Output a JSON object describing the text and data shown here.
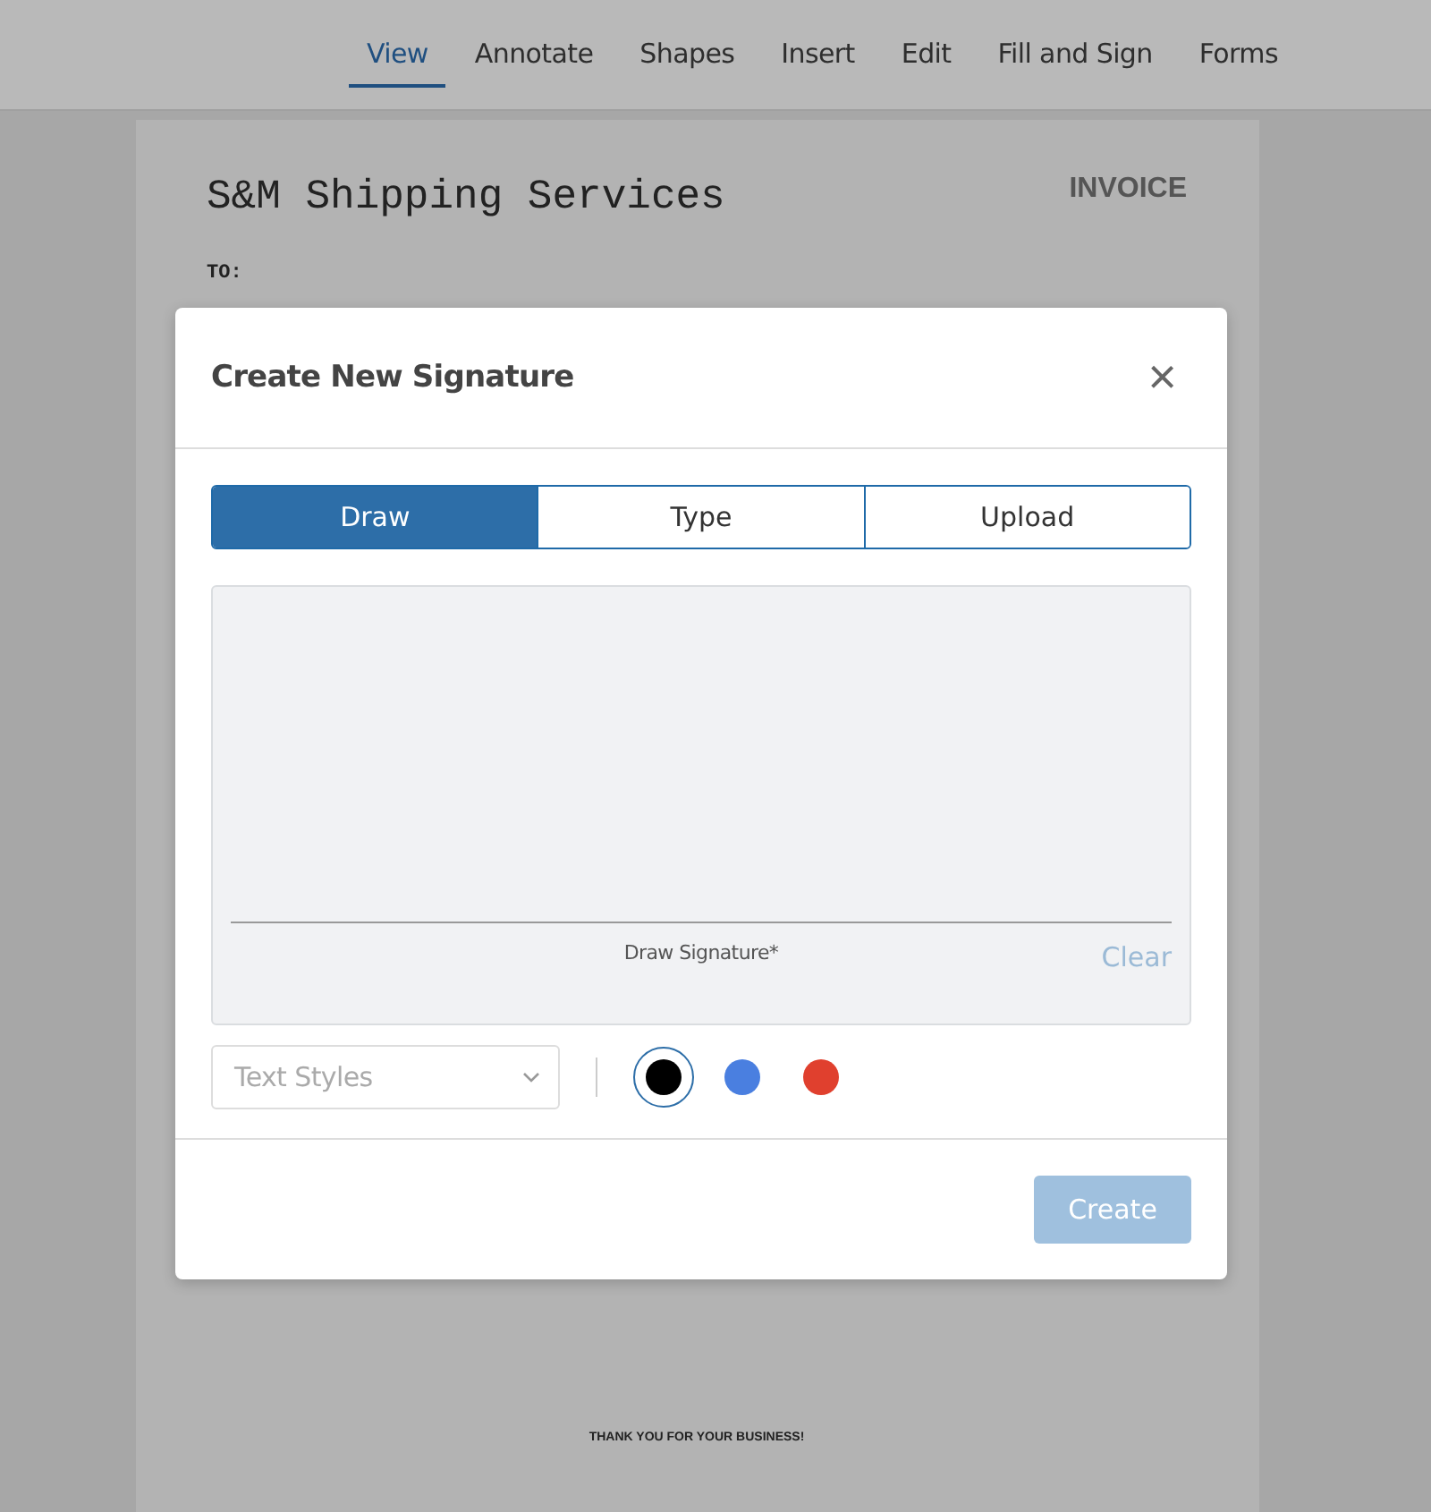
{
  "toolbar": {
    "tabs": [
      {
        "label": "View",
        "selected": true
      },
      {
        "label": "Annotate",
        "selected": false
      },
      {
        "label": "Shapes",
        "selected": false
      },
      {
        "label": "Insert",
        "selected": false
      },
      {
        "label": "Edit",
        "selected": false
      },
      {
        "label": "Fill and Sign",
        "selected": false
      },
      {
        "label": "Forms",
        "selected": false
      }
    ]
  },
  "document": {
    "company": "S&M Shipping Services",
    "heading": "INVOICE",
    "to_label": "TO:",
    "footer": "THANK YOU FOR YOUR BUSINESS!"
  },
  "dialog": {
    "title": "Create New Signature",
    "close": "×",
    "tabs": [
      {
        "label": "Draw",
        "selected": true
      },
      {
        "label": "Type",
        "selected": false
      },
      {
        "label": "Upload",
        "selected": false
      }
    ],
    "pad_hint": "Draw Signature*",
    "clear": "Clear",
    "style_select": {
      "placeholder": "Text Styles"
    },
    "colors": [
      {
        "color": "#000000",
        "selected": true
      },
      {
        "color": "#4a7fe0",
        "selected": false
      },
      {
        "color": "#e0402e",
        "selected": false
      }
    ],
    "create": {
      "label": "Create",
      "disabled": true
    }
  }
}
